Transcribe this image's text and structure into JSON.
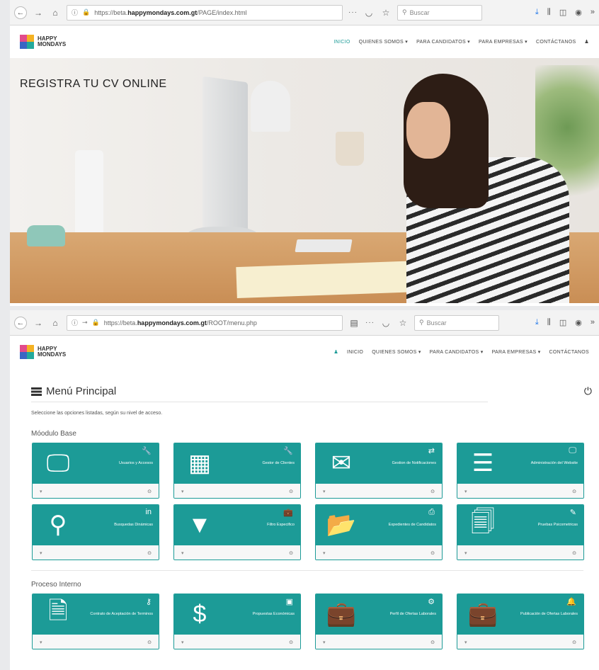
{
  "browser1": {
    "url_prefix": "https://beta.",
    "url_domain": "happymondays.com.gt",
    "url_path": "/PAGE/index.html",
    "search_placeholder": "Buscar"
  },
  "browser2": {
    "url_prefix": "https://beta.",
    "url_domain": "happymondays.com.gt",
    "url_path": "/ROOT/menu.php",
    "search_placeholder": "Buscar"
  },
  "logo": {
    "line1": "HAPPY",
    "line2": "MONDAYS"
  },
  "nav1": [
    "INICIO",
    "QUIENES SOMOS ▾",
    "PARA CANDIDATOS ▾",
    "PARA EMPRESAS ▾",
    "CONTÁCTANOS"
  ],
  "nav2": [
    "INICIO",
    "QUIENES SOMOS ▾",
    "PARA CANDIDATOS ▾",
    "PARA EMPRESAS ▾",
    "CONTÁCTANOS"
  ],
  "hero": {
    "title": "REGISTRA TU CV ONLINE"
  },
  "menu": {
    "title": "Menú Principal",
    "instructions": "Seleccione las opciones listadas, según su nivel de acceso.",
    "section1": "Móodulo Base",
    "section2": "Proceso Interno"
  },
  "cards1": [
    {
      "label": "Usuarios y Accesos",
      "big_icon": "monitor-icon",
      "small_icon": "wrench-icon",
      "glyph": "🖵",
      "small": "🔧"
    },
    {
      "label": "Gestor de Clientes",
      "big_icon": "building-icon",
      "small_icon": "wrench-icon",
      "glyph": "▦",
      "small": "🔧"
    },
    {
      "label": "Gestion de Notificaciones",
      "big_icon": "envelope-icon",
      "small_icon": "transfer-icon",
      "glyph": "✉",
      "small": "⇄"
    },
    {
      "label": "Administración del Website",
      "big_icon": "server-icon",
      "small_icon": "desktop-icon",
      "glyph": "☰",
      "small": "🖵"
    },
    {
      "label": "Busquedas Dinámicas",
      "big_icon": "search-icon",
      "small_icon": "linkedin-icon",
      "glyph": "⚲",
      "small": "in"
    },
    {
      "label": "Filtro Especifico",
      "big_icon": "filter-icon",
      "small_icon": "briefcase-icon",
      "glyph": "▼",
      "small": "💼"
    },
    {
      "label": "Expedientes de Candidatos",
      "big_icon": "folder-open-icon",
      "small_icon": "print-icon",
      "glyph": "📂",
      "small": "⎙"
    },
    {
      "label": "Pruebas Psicometricas",
      "big_icon": "files-icon",
      "small_icon": "pencil-icon",
      "glyph": "🗐",
      "small": "✎"
    }
  ],
  "cards2": [
    {
      "label": "Contrato de Aceptación de Terminos",
      "big_icon": "document-icon",
      "small_icon": "key-icon",
      "glyph": "🗎",
      "small": "⚷"
    },
    {
      "label": "Propuestas Económicas",
      "big_icon": "dollar-icon",
      "small_icon": "money-icon",
      "glyph": "$",
      "small": "▣"
    },
    {
      "label": "Perfil de Ofertas Laborales",
      "big_icon": "suitcase-icon",
      "small_icon": "cogs-icon",
      "glyph": "💼",
      "small": "⚙"
    },
    {
      "label": "Publicación de Ofertas Laborales",
      "big_icon": "suitcase-icon",
      "small_icon": "bell-icon",
      "glyph": "💼",
      "small": "🔔"
    }
  ],
  "card_footer": {
    "left": "▾",
    "right": "⊙"
  },
  "colors": {
    "teal": "#1c9b97"
  }
}
